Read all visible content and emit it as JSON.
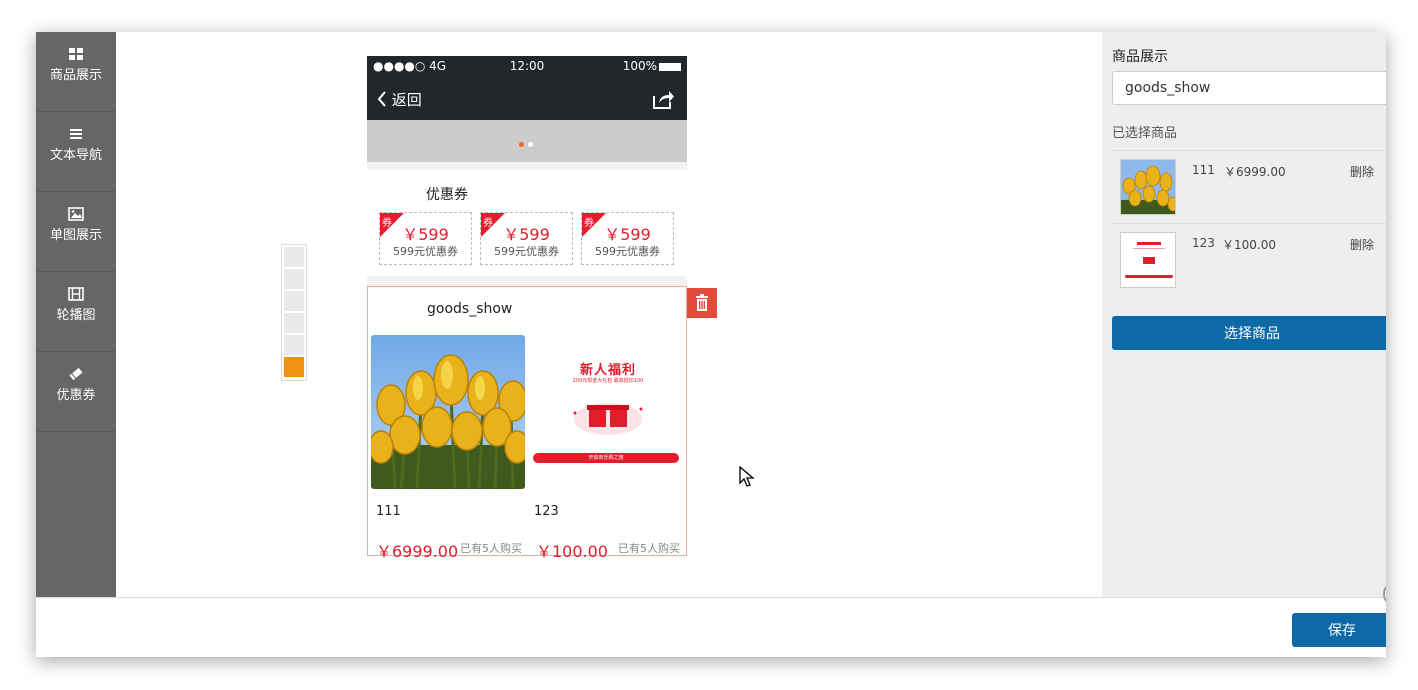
{
  "sidebar": {
    "items": [
      {
        "label": "商品展示",
        "icon": "grid-icon"
      },
      {
        "label": "文本导航",
        "icon": "menu-lines-icon"
      },
      {
        "label": "单图展示",
        "icon": "image-icon"
      },
      {
        "label": "轮播图",
        "icon": "film-icon"
      },
      {
        "label": "优惠券",
        "icon": "ticket-icon"
      }
    ]
  },
  "phone": {
    "status": {
      "signal": "●●●●○ 4G",
      "time": "12:00",
      "battery": "100%"
    },
    "nav": {
      "back_label": "返回"
    },
    "coupon_section": {
      "title": "优惠券",
      "tag": "券",
      "coupons": [
        {
          "amount": "￥599",
          "desc": "599元优惠券"
        },
        {
          "amount": "￥599",
          "desc": "599元优惠券"
        },
        {
          "amount": "￥599",
          "desc": "599元优惠券"
        }
      ]
    },
    "goods_section": {
      "title": "goods_show",
      "promo": {
        "title": "新人福利",
        "subtitle": "200元现金大礼包 最高抵扣100",
        "button": "开启商乐购之旅"
      },
      "items": [
        {
          "name": "111",
          "price": "￥6999.00",
          "sold": "已有5人购买"
        },
        {
          "name": "123",
          "price": "￥100.00",
          "sold": "已有5人购买"
        }
      ]
    }
  },
  "panel": {
    "title": "商品展示",
    "input_value": "goods_show",
    "selected_label": "已选择商品",
    "selected": [
      {
        "name": "111",
        "price": "￥6999.00",
        "delete": "删除"
      },
      {
        "name": "123",
        "price": "￥100.00",
        "delete": "删除"
      }
    ],
    "choose_button": "选择商品"
  },
  "footer": {
    "save_button": "保存"
  },
  "colors": {
    "accent": "#0e6aa6",
    "price_red": "#e41d2d",
    "sidebar": "#666666",
    "indicator_active": "#f39212"
  }
}
